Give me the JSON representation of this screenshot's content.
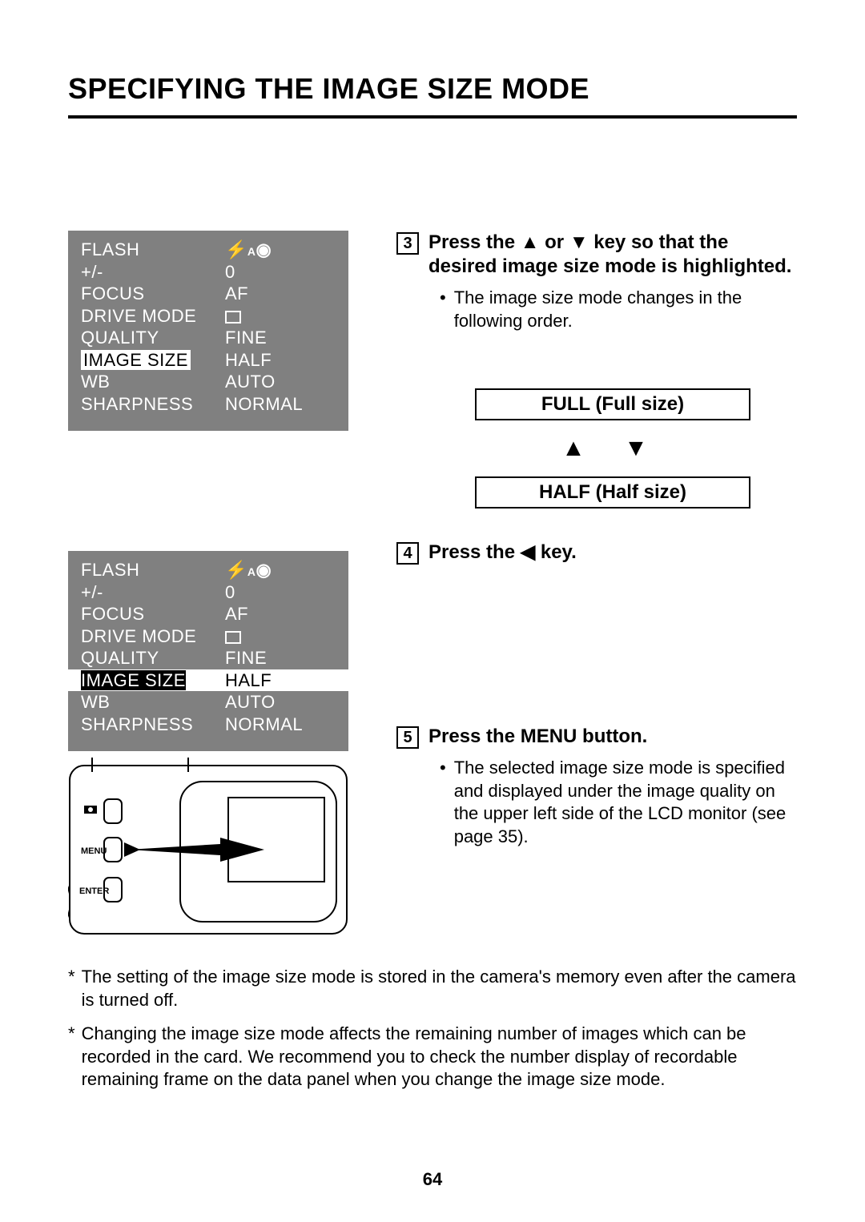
{
  "title": "SPECIFYING THE IMAGE SIZE MODE",
  "page_number": "64",
  "menu": {
    "rows": [
      {
        "label": "FLASH",
        "value_icon": "flash-redeye"
      },
      {
        "label": "+/-",
        "value": "0"
      },
      {
        "label": "FOCUS",
        "value": "AF"
      },
      {
        "label": "DRIVE MODE",
        "value_icon": "square"
      },
      {
        "label": "QUALITY",
        "value": "FINE"
      },
      {
        "label": "IMAGE SIZE",
        "value": "HALF",
        "highlighted_label": true
      },
      {
        "label": "WB",
        "value": "AUTO"
      },
      {
        "label": "SHARPNESS",
        "value": "NORMAL"
      }
    ]
  },
  "steps": {
    "s3": {
      "num": "3",
      "text": "Press the ▲ or ▼ key so that the desired image size mode is highlighted.",
      "bullet": "The image size mode changes in the following order."
    },
    "s4": {
      "num": "4",
      "text": "Press the ◀ key."
    },
    "s5": {
      "num": "5",
      "text": "Press the MENU button.",
      "bullet": "The selected image size mode is specified and displayed under the image quality on the upper left side of the LCD monitor (see page 35)."
    }
  },
  "size_order": {
    "full": "FULL (Full size)",
    "half": "HALF (Half size)",
    "arrows": "▲  ▼"
  },
  "footnotes": [
    "The setting of the image size mode is stored in the camera's memory even after the camera is turned off.",
    "Changing the image size mode affects the remaining number of images which can be recorded in the card. We recommend you to check the number display of recordable remaining frame on the data panel when you change the image size mode."
  ],
  "diagram_labels": {
    "menu": "MENU",
    "enter": "ENTER",
    "camera_icon": "camera-icon"
  }
}
